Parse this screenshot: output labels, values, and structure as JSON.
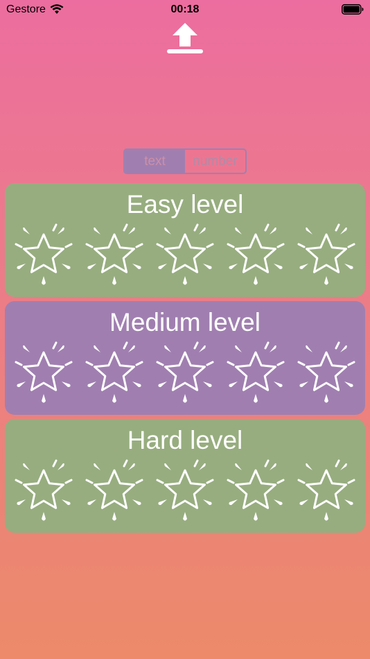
{
  "status_bar": {
    "carrier": "Gestore",
    "time": "00:18"
  },
  "header": {
    "icon": "upload-icon"
  },
  "mode_toggle": {
    "options": [
      "text",
      "number"
    ],
    "selected": "text"
  },
  "levels": [
    {
      "label": "Easy level",
      "stars_earned": 0,
      "stars_total": 5,
      "color": "#97ad7f"
    },
    {
      "label": "Medium level",
      "stars_earned": 0,
      "stars_total": 5,
      "color": "#a07fb0"
    },
    {
      "label": "Hard level",
      "stars_earned": 0,
      "stars_total": 5,
      "color": "#97ad7f"
    }
  ]
}
